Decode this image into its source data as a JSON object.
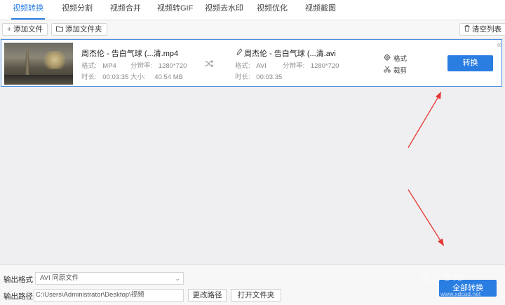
{
  "tabs": [
    "视频转换",
    "视频分割",
    "视频合并",
    "视频转GIF",
    "视频去水印",
    "视频优化",
    "视频截图"
  ],
  "active_tab": "视频转换",
  "toolbar": {
    "add_file": "添加文件",
    "add_folder": "添加文件夹",
    "clear_list": "清空列表"
  },
  "item": {
    "source": {
      "name": "周杰伦 - 告白气球 (...清.mp4",
      "format_label": "格式:",
      "format": "MP4",
      "resolution_label": "分辨率:",
      "resolution": "1280*720",
      "duration_label": "时长:",
      "duration": "00:03:35",
      "size_label": "大小:",
      "size": "40.54 MB"
    },
    "target": {
      "name": "周杰伦 - 告白气球 (...清.avi",
      "format_label": "格式:",
      "format": "AVI",
      "resolution_label": "分辨率:",
      "resolution": "1280*720",
      "duration_label": "时长:",
      "duration": "00:03:35"
    },
    "options": {
      "format": "格式",
      "crop": "裁剪"
    },
    "convert_button": "转换"
  },
  "bottom": {
    "output_format_label": "输出格式",
    "output_format_value": "AVI  同原文件",
    "output_path_label": "输出路径",
    "output_path_value": "C:\\Users\\Administrator\\Desktop\\视频",
    "change_path": "更改路径",
    "open_folder": "打开文件夹",
    "convert_all": "全部转换"
  },
  "watermark": {
    "logo": "电脑 640",
    "url": "www.xdcad.net"
  },
  "colors": {
    "accent": "#2a7de1",
    "annotation_arrow": "#e53935"
  }
}
